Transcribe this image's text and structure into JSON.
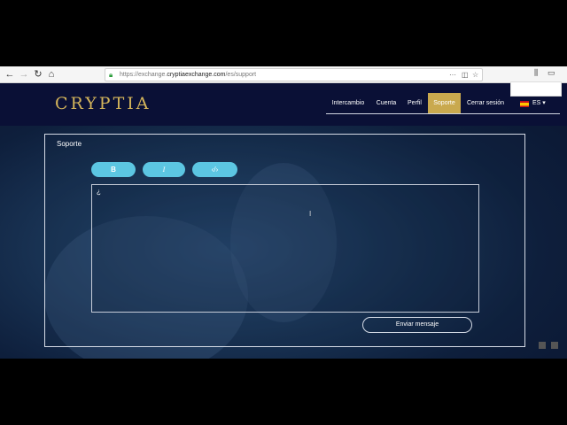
{
  "browser": {
    "url_prefix": "https://exchange.",
    "url_domain": "cryptiaexchange.com",
    "url_path": "/es/support"
  },
  "site": {
    "logo": "CRYPTIA",
    "menu": [
      "Intercambio",
      "Cuenta",
      "Perfil",
      "Soporte",
      "Cerrar sesión"
    ],
    "active_menu": "Soporte",
    "language": "ES ▾",
    "accent_color": "#c9a94e"
  },
  "support": {
    "title": "Soporte",
    "bold_label": "B",
    "italic_label": "I",
    "code_label": "‹/›",
    "editor_content": "¿",
    "send_label": "Enviar mensaje"
  }
}
